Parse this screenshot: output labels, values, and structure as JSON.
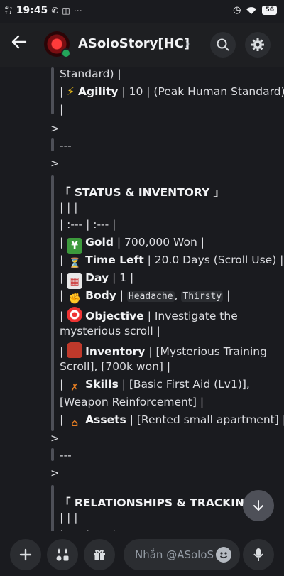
{
  "status_bar": {
    "network_top": "4G",
    "network_bottom": "↑↓",
    "time": "19:45",
    "battery": "56"
  },
  "header": {
    "channel_title": "ASoloStory[HC]",
    "chevron": "›"
  },
  "message": {
    "l1": "Standard) |",
    "agility_pre": "| ",
    "agility_emoji": "⚡",
    "agility_label": "Agility",
    "agility_rest": " | 10 | (Peak Human Standard)",
    "l3": "|",
    "gt1": ">",
    "sep1": "---",
    "gt2": ">",
    "status_heading": "「 STATUS & INVENTORY 」",
    "table_head": "| | |",
    "table_align": "| :--- | :--- |",
    "gold_label": "Gold",
    "gold_value": " | 700,000 Won |",
    "time_label": "Time Left",
    "time_value": " | 20.0 Days (Scroll Use) |",
    "day_label": "Day",
    "day_value": " | 1 |",
    "body_label": "Body",
    "body_code1": "Headache",
    "body_code2": "Thirsty",
    "objective_label": "Objective",
    "objective_value": " | Investigate the",
    "objective_cont": "mysterious scroll |",
    "inventory_label": "Inventory",
    "inventory_value": " | [Mysterious Training",
    "inventory_cont": "Scroll], [700k won] |",
    "skills_label": "Skills",
    "skills_value": " | [Basic First Aid (Lv1)],",
    "skills_cont": "[Weapon Reinforcement] |",
    "assets_label": "Assets",
    "assets_value": " | [Rented small apartment] |",
    "gt3": ">",
    "sep2": "---",
    "gt4": ">",
    "relationships_heading": "「 RELATIONSHIPS & TRACKING 」",
    "table_head2": "| | |",
    "table_align2": "| :--- | :--- |"
  },
  "composer": {
    "placeholder": "Nhắn @ASoloStory[HC]"
  },
  "icons": {
    "back": "arrow-left-icon",
    "search": "search-icon",
    "settings": "gear-icon",
    "add": "plus-icon",
    "apps": "apps-icon",
    "gift": "gift-icon",
    "emoji": "emoji-icon",
    "mic": "microphone-icon",
    "scroll_down": "arrow-down-icon"
  },
  "colors": {
    "background": "#1a1b1f",
    "header": "#1e1f22",
    "quote_bar": "#4e5058",
    "online": "#23a55a"
  }
}
